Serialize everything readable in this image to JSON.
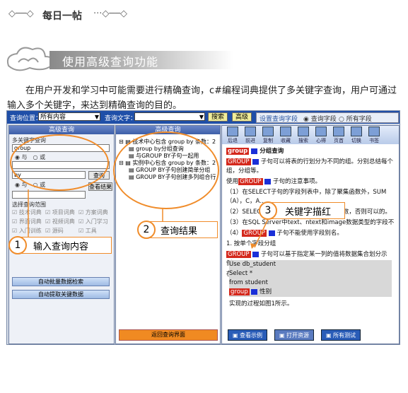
{
  "header": {
    "ornament_left": "◇──◇",
    "title": "每日一帖",
    "ornament_right": "···◇──◇"
  },
  "banner": {
    "title": "使用高级查询功能"
  },
  "intro": {
    "text": "在用户开发和学习中可能需要进行精确查询，c#编程词典提供了多关键字查询，用户可通过输入多个关键字，来达到精确查询的目的。"
  },
  "toolbar": {
    "location_label": "查询位置：",
    "location_value": "所有内容",
    "keyword_label": "查询文字：",
    "search_btn": "搜索",
    "advanced_btn": "高级",
    "settings_label": "设置查询字段",
    "radio1": "查询字段",
    "radio2": "所有字段"
  },
  "left_panel": {
    "title": "高级查询",
    "multi_keyword": "多关键字查询",
    "field1": "group",
    "radio_and": "与",
    "radio_or": "或",
    "field2": "by",
    "query_btn": "查询",
    "view_btn": "查看结果",
    "range_title": "选择查询范围",
    "ranges": [
      "技术词典",
      "项目词典",
      "方案词典",
      "界面词典",
      "视频词典",
      "入门学习",
      "入门训练",
      "源码",
      "工具",
      "白宝箱",
      "英语词典"
    ],
    "batch_btn": "自动批量数据检索",
    "extract_btn": "自动提取关键数据"
  },
  "mid_panel": {
    "title": "高级查询",
    "groups": [
      {
        "label": "技术中心包含 group by 条数：2",
        "items": [
          "group by分组查询",
          "与GROUP BY子句一起用"
        ]
      },
      {
        "label": "实例中心包含 group by 条数：2",
        "items": [
          "GROUP BY子句创建简单分组",
          "GROUP BY子句创建多列组合行"
        ]
      }
    ],
    "footer_btn": "返回查询界面"
  },
  "right_panel": {
    "icons": [
      "后退",
      "前进",
      "复制",
      "收藏",
      "搜索",
      "心得",
      "页首",
      "切换",
      "书签"
    ],
    "lines": [
      {
        "kw": "group",
        "after": "分组查询",
        "bold": true
      },
      {
        "kw": "GROUP",
        "after": "子句可以将表的行划分为不同的组。分别总结每个组，分组等。"
      },
      {
        "plain": "使用",
        "kw": "GROUP",
        "after": "子句的注意事项。"
      },
      {
        "plain": "（1）在SELECT子句的字段列表中，除了聚集函数外，SUM（A），C，A…"
      },
      {
        "plain": "（2）SELECT字段中的字段必须在有聚集函数，否则可以的。"
      },
      {
        "plain": "（3）在SQL Server中text、ntext和image数据类型的字段不"
      },
      {
        "plain": "（4）",
        "kw": "GROUP",
        "after": "子句不能使用字段别名。"
      },
      {
        "plain": "1.  按单个字段分组"
      },
      {
        "kw": "GROUP",
        "after": "子句可以基于指定某一列的值将数据集合划分示例："
      },
      {
        "plain": "在student表中，按照“性别”分组。SQL语句如下。"
      }
    ],
    "code": [
      "Use db_student",
      "Select *",
      "from student",
      "group  性别"
    ],
    "after_code": "实现的过程如图1所示。",
    "footer": [
      "查看示例",
      "打开资源",
      "所有测试"
    ]
  },
  "callouts": [
    {
      "num": "1",
      "text": "输入查询内容"
    },
    {
      "num": "2",
      "text": "查询结果"
    },
    {
      "num": "3",
      "text": "关键字描红"
    }
  ]
}
